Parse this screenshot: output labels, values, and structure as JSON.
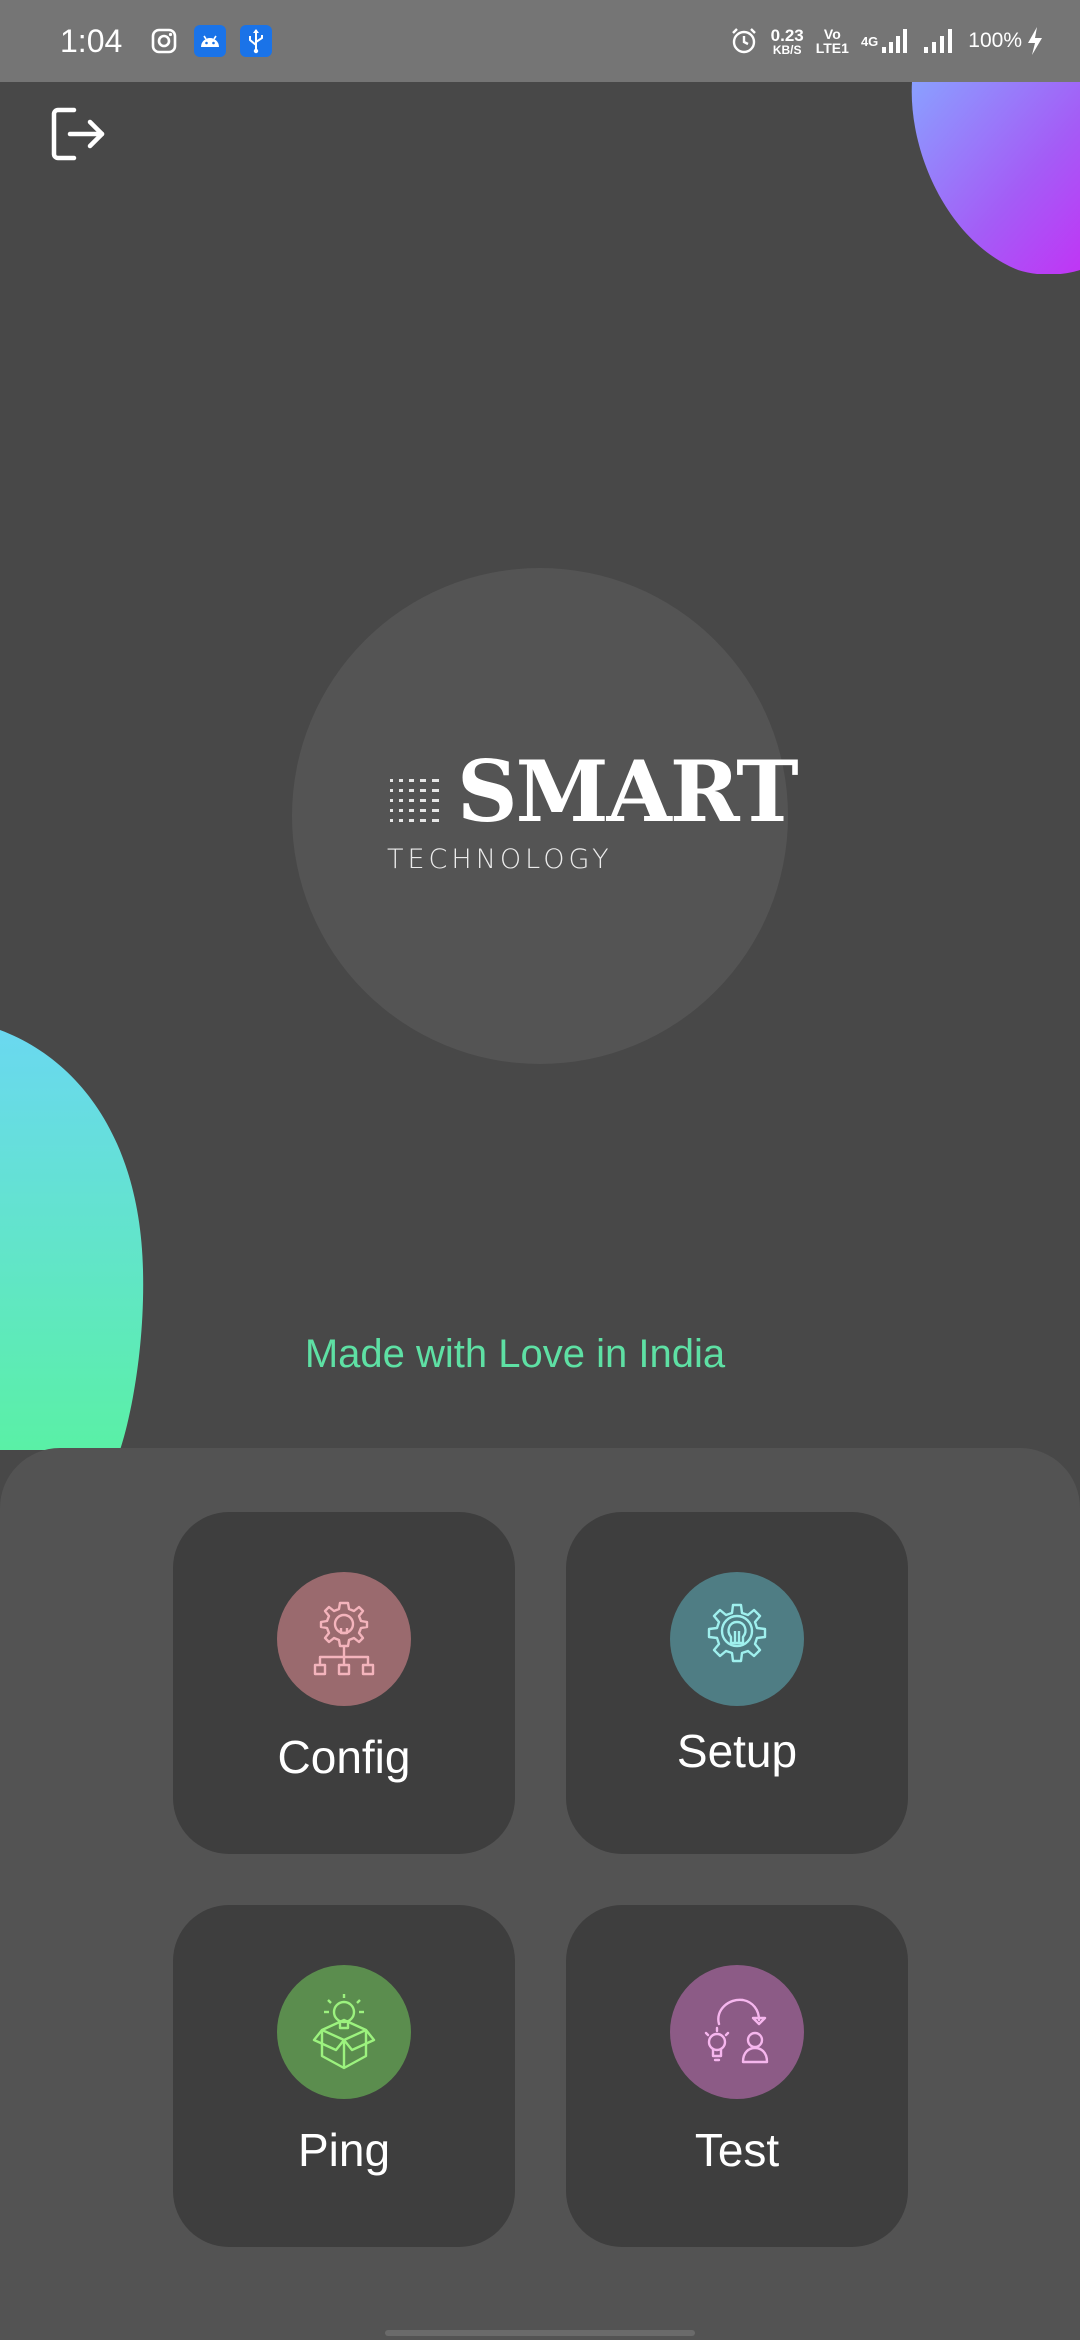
{
  "status_bar": {
    "time": "1:04",
    "net_speed_value": "0.23",
    "net_speed_unit": "KB/S",
    "volte_top": "Vo",
    "volte_bottom": "LTE1",
    "network_type": "4G",
    "battery": "100%",
    "icons": [
      "instagram-icon",
      "android-icon",
      "usb-icon",
      "alarm-icon",
      "signal-icon",
      "signal-icon",
      "charging-icon"
    ]
  },
  "logo": {
    "brand": "SMART",
    "subtitle": "TECHNOLOGY"
  },
  "tagline": "Made with Love in India",
  "cards": [
    {
      "label": "Config",
      "icon": "network-bulb-icon",
      "color": "#9a6a6e"
    },
    {
      "label": "Setup",
      "icon": "gear-bulb-icon",
      "color": "#4f7d84"
    },
    {
      "label": "Ping",
      "icon": "bulb-box-icon",
      "color": "#5b8d4e"
    },
    {
      "label": "Test",
      "icon": "idea-person-icon",
      "color": "#8c5b86"
    }
  ],
  "colors": {
    "background": "#484848",
    "accent_text": "#5ee0a4",
    "card": "#3e3e3e",
    "panel": "#535353",
    "blob_top": "#b44cf0",
    "blob_left": "#5de8b4"
  }
}
